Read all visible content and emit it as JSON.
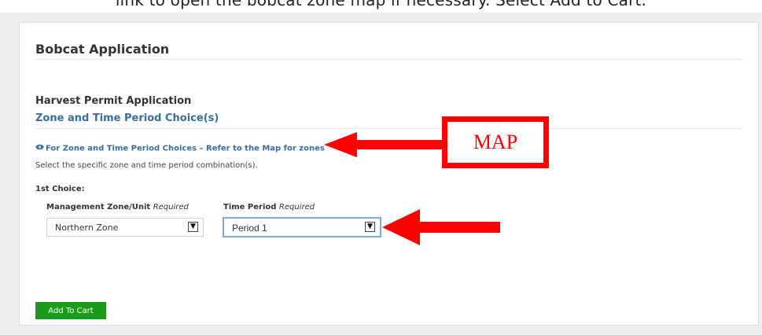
{
  "top_instruction": "link to open the bobcat zone map if necessary. Select Add to Cart.",
  "card_title": "Bobcat Application",
  "section_title": "Harvest Permit Application",
  "subsection_title": "Zone and Time Period Choice(s)",
  "map_link": "For Zone and Time Period Choices – Refer to the Map for zones",
  "helper_text": "Select the specific zone and time period combination(s).",
  "choice_label": "1st Choice:",
  "fields": {
    "zone": {
      "label": "Management Zone/Unit",
      "required": "Required",
      "value": "Northern Zone"
    },
    "period": {
      "label": "Time Period",
      "required": "Required",
      "value": "Period 1"
    }
  },
  "add_to_cart_label": "Add To Cart",
  "annotation": {
    "map_label": "MAP",
    "color": "#ff0000"
  },
  "colors": {
    "link": "#3a6d9c",
    "button": "#1c9a1c"
  },
  "icons": {
    "eye": "eye-icon",
    "chevron": "chevron-down-icon"
  }
}
